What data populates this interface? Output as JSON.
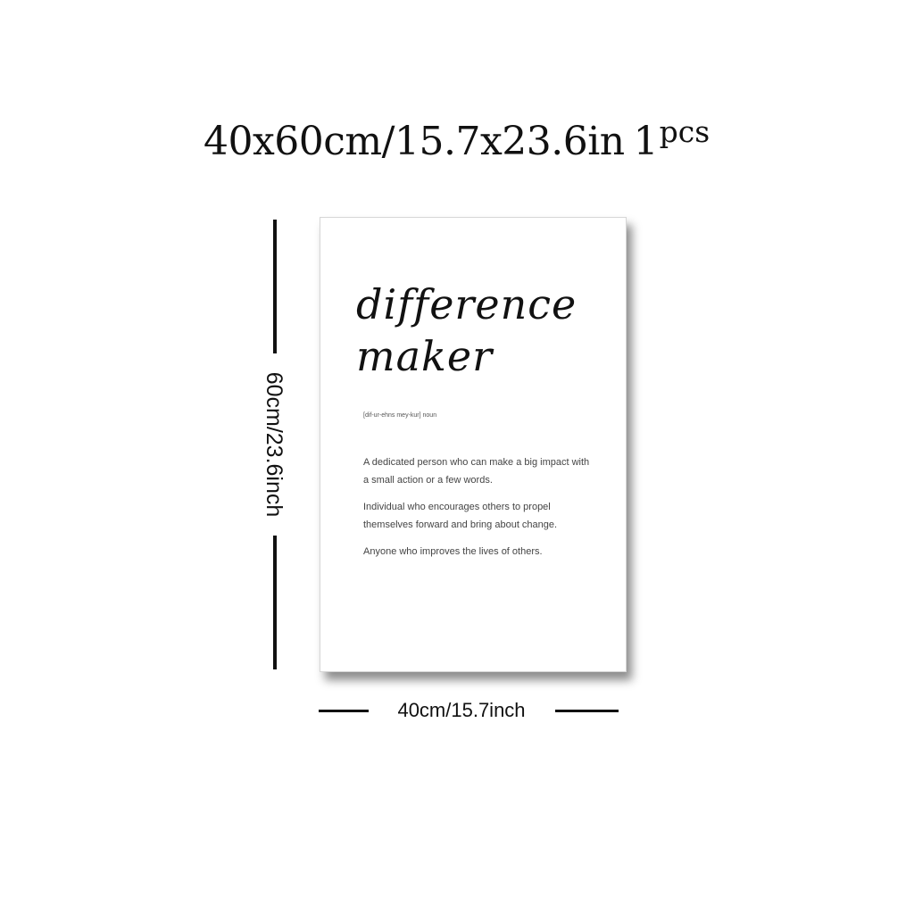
{
  "heading": {
    "size": "40x60cm/15.7x23.6in",
    "count": "1",
    "unit": "pcs"
  },
  "dimensions": {
    "height_label": "60cm/23.6inch",
    "width_label": "40cm/15.7inch"
  },
  "poster": {
    "title_line1": "difference",
    "title_line2": "maker",
    "pronunciation": "[dif-ur-ehns mey-kur] noun",
    "definitions": [
      "A dedicated person who can make a big impact with a small action or a few words.",
      "Individual who encourages others to propel themselves forward and bring about change.",
      "Anyone who improves the lives of others."
    ]
  }
}
